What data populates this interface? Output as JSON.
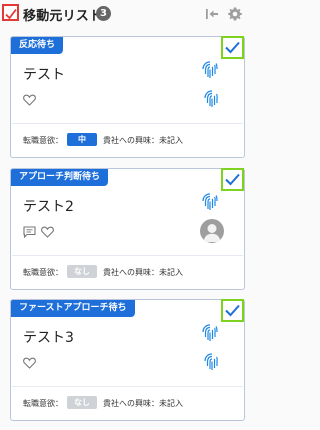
{
  "header": {
    "title": "移動元リスト",
    "count": "3"
  },
  "cards": [
    {
      "status_tag": "反応待ち",
      "name": "テスト",
      "intent_label": "転職意欲：",
      "intent_value": "中",
      "interest_label": "貴社への興味：未記入"
    },
    {
      "status_tag": "アプローチ判断待ち",
      "name": "テスト2",
      "intent_label": "転職意欲：",
      "intent_value": "なし",
      "interest_label": "貴社への興味：未記入"
    },
    {
      "status_tag": "ファーストアプローチ待ち",
      "name": "テスト3",
      "intent_label": "転職意欲：",
      "intent_value": "なし",
      "interest_label": "貴社への興味：未記入"
    }
  ],
  "colors": {
    "accent_blue": "#1e6fd9",
    "check_green": "#7ed321",
    "check_red": "#e53935",
    "pill_gray": "#cfd3d8"
  },
  "icons": [
    "checkmark-icon",
    "collapse-left-icon",
    "gear-icon",
    "fingerprint-icon",
    "heart-icon",
    "comment-icon",
    "avatar-icon"
  ]
}
